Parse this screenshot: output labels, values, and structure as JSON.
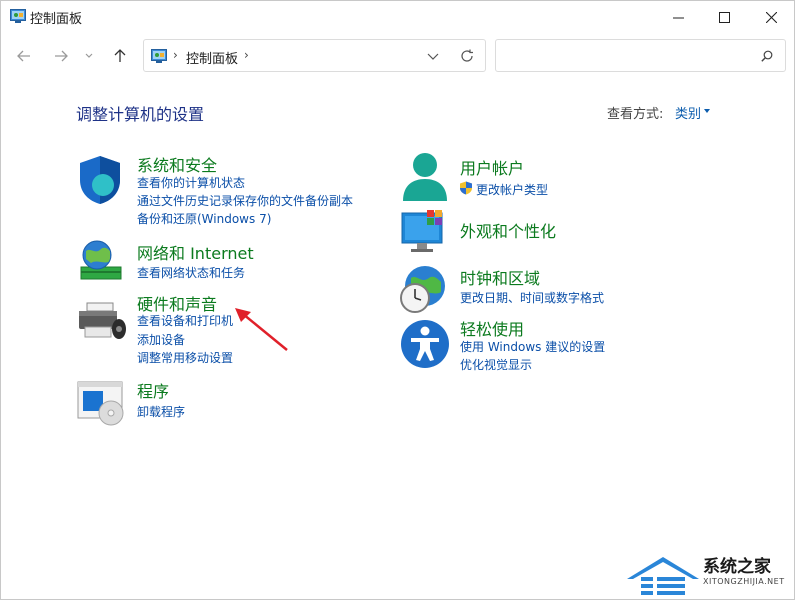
{
  "window": {
    "title": "控制面板"
  },
  "nav": {
    "breadcrumb": "控制面板",
    "separator": "›",
    "search_placeholder": ""
  },
  "content": {
    "page_title": "调整计算机的设置",
    "view_by_label": "查看方式:",
    "view_by_value": "类别"
  },
  "categories": {
    "system": {
      "title": "系统和安全",
      "links": [
        "查看你的计算机状态",
        "通过文件历史记录保存你的文件备份副本",
        "备份和还原(Windows 7)"
      ]
    },
    "network": {
      "title": "网络和 Internet",
      "links": [
        "查看网络状态和任务"
      ]
    },
    "hardware": {
      "title": "硬件和声音",
      "links": [
        "查看设备和打印机",
        "添加设备",
        "调整常用移动设置"
      ]
    },
    "programs": {
      "title": "程序",
      "links": [
        "卸载程序"
      ]
    },
    "accounts": {
      "title": "用户帐户",
      "links": [
        "更改帐户类型"
      ]
    },
    "appearance": {
      "title": "外观和个性化",
      "links": []
    },
    "clock": {
      "title": "时钟和区域",
      "links": [
        "更改日期、时间或数字格式"
      ]
    },
    "ease": {
      "title": "轻松使用",
      "links": [
        "使用 Windows 建议的设置",
        "优化视觉显示"
      ]
    }
  },
  "watermark": {
    "text": "系统之家",
    "sub": "XITONGZHIJIA.NET"
  },
  "colors": {
    "title_blue": "#1e3287",
    "category_green": "#0b7a1e",
    "link_blue": "#0b4fa8",
    "annotation_red": "#e0202a"
  }
}
